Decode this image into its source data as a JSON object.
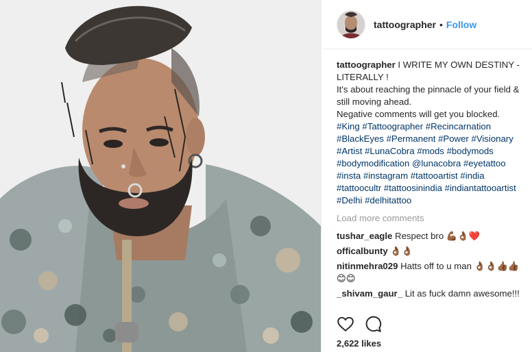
{
  "header": {
    "username": "tattoographer",
    "separator": "•",
    "follow_label": "Follow"
  },
  "caption": {
    "username": "tattoographer",
    "lines": [
      "I WRITE MY OWN DESTINY - LITERALLY !",
      "It's about reaching the pinnacle of your field & still moving ahead.",
      "Negative comments will get you blocked."
    ],
    "hashtags": [
      "#King",
      "#Tattoographer",
      "#Recincarnation",
      "#BlackEyes",
      "#Permanent",
      "#Power",
      "#Visionary",
      "#Artist",
      "#LunaCobra",
      "#mods",
      "#bodymods",
      "#bodymodification",
      "@lunacobra",
      "#eyetattoo",
      "#insta",
      "#instagram",
      "#tattooartist",
      "#india",
      "#tattoocultr",
      "#tattoosinindia",
      "#indiantattooartist",
      "#Delhi",
      "#delhitattoo"
    ]
  },
  "load_more_label": "Load more comments",
  "comments": [
    {
      "user": "tushar_eagle",
      "text": "Respect bro 💪🏾👌🏾❤️"
    },
    {
      "user": "officalbunty",
      "text": "👌🏾👌🏾"
    },
    {
      "user": "nitinmehra029",
      "text": "Hatts off to u man 👌🏾👌🏾👍🏾👍🏾 😊😊"
    },
    {
      "user": "_shivam_gaur_",
      "text": "Lit as fuck damn awesome!!!"
    }
  ],
  "actions": {
    "like_icon": "heart-outline",
    "comment_icon": "speech-bubble"
  },
  "likes_label": "2,622 likes"
}
